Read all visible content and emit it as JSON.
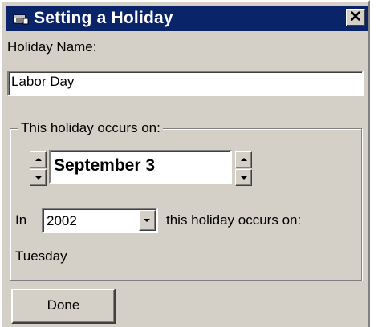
{
  "window": {
    "title": "Setting a Holiday",
    "icon": "calendar-window-icon",
    "close_glyph": "✕",
    "colors": {
      "titlebar": "#0a246a",
      "face": "#d4d0c8"
    }
  },
  "holiday_name": {
    "label": "Holiday Name:",
    "value": "Labor Day"
  },
  "occurs_group": {
    "legend": "This holiday occurs on:",
    "date_value": "September 3",
    "in_label": "In",
    "year_value": "2002",
    "occurs_on_label": "this holiday occurs on:",
    "weekday": "Tuesday"
  },
  "buttons": {
    "done_label": "Done"
  }
}
